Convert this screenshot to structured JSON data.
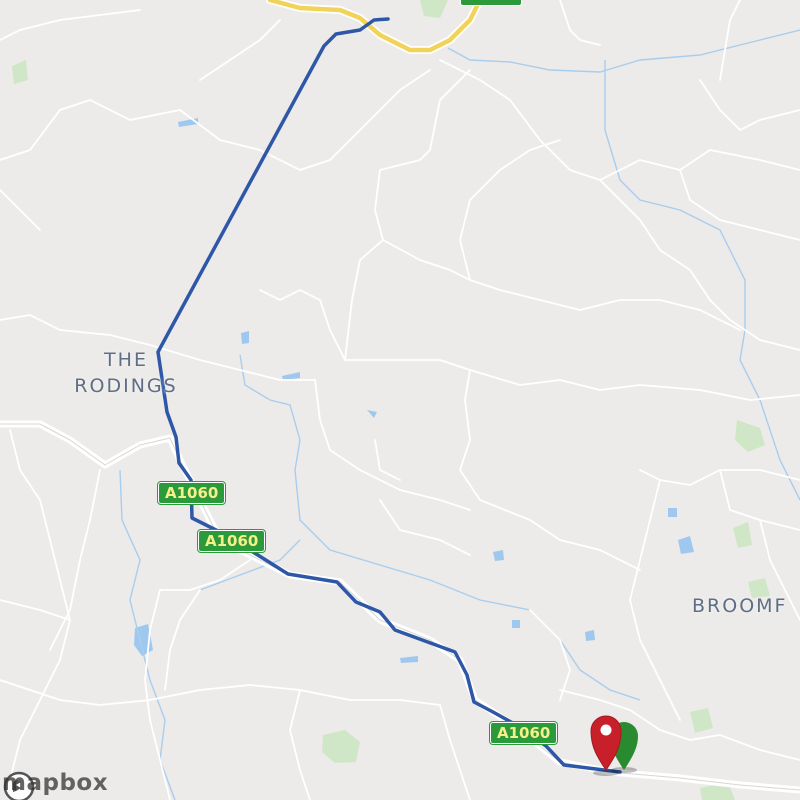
{
  "map": {
    "places": [
      {
        "name": "the-rodings",
        "lines": [
          "THE",
          "RODINGS"
        ]
      },
      {
        "name": "broomfield",
        "lines": [
          "BROOMF"
        ]
      }
    ],
    "road_shields": [
      "A1060",
      "A1060",
      "A1060"
    ],
    "attribution": "mapbox",
    "route_color": "#2e57a8",
    "start_marker_color": "#2a8a2f",
    "end_marker_color": "#c8202b",
    "icons": [
      "destination-marker-icon",
      "origin-marker-icon",
      "mapbox-logo-icon"
    ]
  }
}
